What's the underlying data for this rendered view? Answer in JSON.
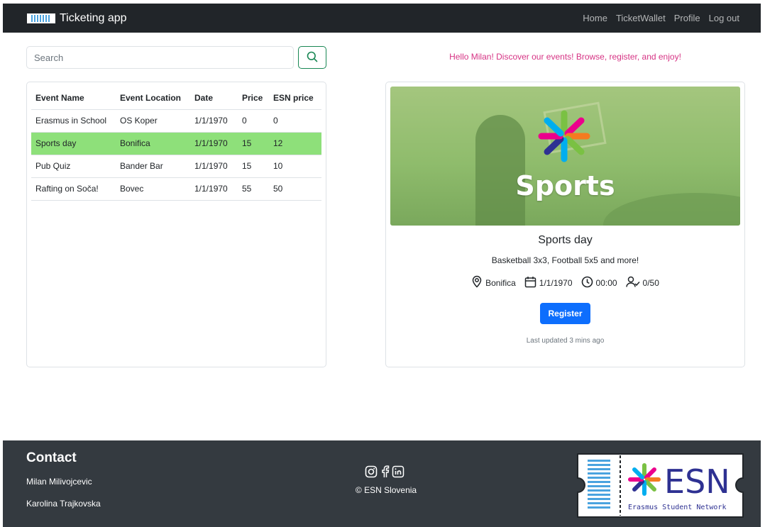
{
  "navbar": {
    "brand": "Ticketing app",
    "links": [
      "Home",
      "TicketWallet",
      "Profile",
      "Log out"
    ]
  },
  "search": {
    "placeholder": "Search"
  },
  "greeting": "Hello Milan! Discover our events! Browse, register, and enjoy!",
  "table": {
    "headers": [
      "Event Name",
      "Event Location",
      "Date",
      "Price",
      "ESN price"
    ],
    "rows": [
      [
        "Erasmus in School",
        "OS Koper",
        "1/1/1970",
        "0",
        "0"
      ],
      [
        "Sports day",
        "Bonifica",
        "1/1/1970",
        "15",
        "12"
      ],
      [
        "Pub Quiz",
        "Bander Bar",
        "1/1/1970",
        "15",
        "10"
      ],
      [
        "Rafting on Soča!",
        "Bovec",
        "1/1/1970",
        "55",
        "50"
      ]
    ],
    "selected_row": 1
  },
  "event": {
    "banner_text": "Sports",
    "title": "Sports day",
    "description": "Basketball 3x3, Football 5x5 and more!",
    "location": "Bonifica",
    "date": "1/1/1970",
    "time": "00:00",
    "capacity": "0/50",
    "register_label": "Register",
    "updated": "Last updated 3 mins ago"
  },
  "footer": {
    "contact_title": "Contact",
    "contacts": [
      "Milan Milivojcevic",
      "Karolina Trajkovska"
    ],
    "copyright": "© ESN Slovenia",
    "social_icons": [
      "instagram-icon",
      "facebook-icon",
      "linkedin-icon"
    ],
    "logo_text": "ESN",
    "logo_subtext": "Erasmus Student Network"
  },
  "colors": {
    "navbar_bg": "#212529",
    "footer_bg": "#343a40",
    "selected_row": "#8ee07a",
    "greeting": "#d63384",
    "primary": "#0d6efd",
    "search_border": "#198754"
  }
}
